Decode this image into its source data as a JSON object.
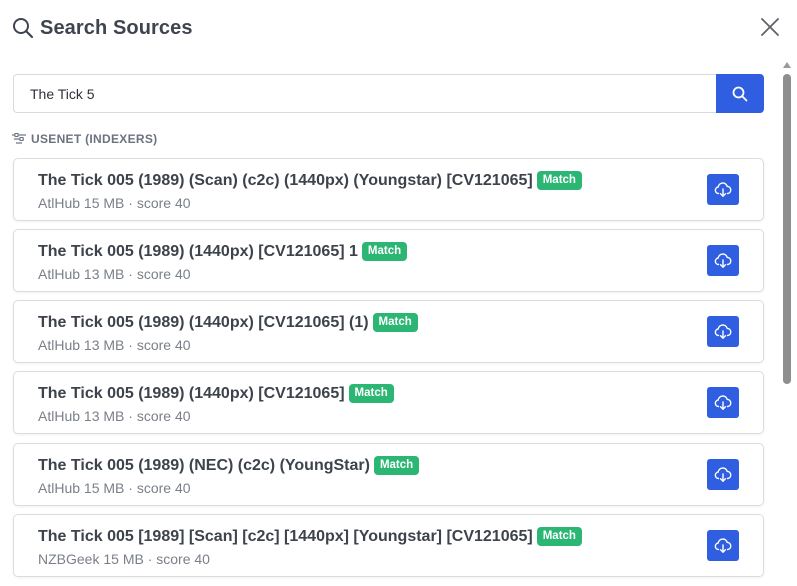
{
  "header": {
    "title": "Search Sources",
    "title_icon": "search-icon",
    "close_icon": "close-icon"
  },
  "search": {
    "value": "The Tick 5",
    "button_icon": "search-icon"
  },
  "section": {
    "label": "USENET (INDEXERS)",
    "icon": "filter-icon"
  },
  "results": [
    {
      "name": "The Tick 005 (1989) (Scan) (c2c) (1440px) (Youngstar) [CV121065]",
      "badge": "Match",
      "meta": "AtlHub 15 MB · score 40"
    },
    {
      "name": "The Tick 005 (1989) (1440px) [CV121065] 1",
      "badge": "Match",
      "meta": "AtlHub 13 MB · score 40"
    },
    {
      "name": "The Tick 005 (1989) (1440px) [CV121065] (1)",
      "badge": "Match",
      "meta": "AtlHub 13 MB · score 40"
    },
    {
      "name": "The Tick 005 (1989) (1440px) [CV121065]",
      "badge": "Match",
      "meta": "AtlHub 13 MB · score 40"
    },
    {
      "name": "The Tick 005 (1989) (NEC) (c2c) (YoungStar)",
      "badge": "Match",
      "meta": "AtlHub 15 MB · score 40"
    },
    {
      "name": "The Tick 005 [1989] [Scan] [c2c] [1440px] [Youngstar] [CV121065]",
      "badge": "Match",
      "meta": "NZBGeek 15 MB · score 40"
    }
  ],
  "colors": {
    "accent": "#2f5fe0",
    "match": "#2bb673"
  }
}
